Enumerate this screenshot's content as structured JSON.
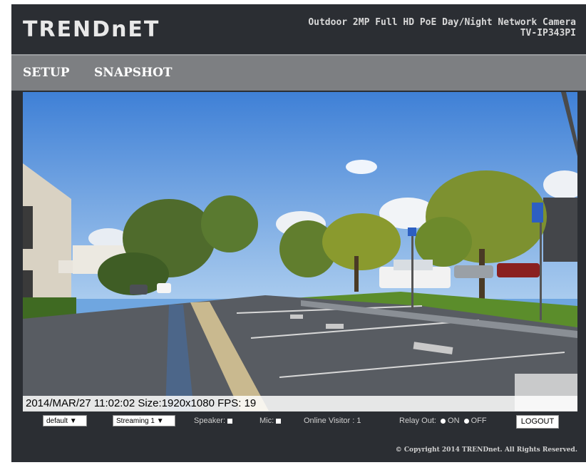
{
  "header": {
    "logo": "TRENDnET",
    "model_line1": "Outdoor 2MP Full HD PoE Day/Night Network Camera",
    "model_line2": "TV-IP343PI"
  },
  "nav": {
    "setup": "SETUP",
    "snapshot": "SNAPSHOT"
  },
  "video": {
    "osd_text": "2014/MAR/27 11:02:02 Size:1920x1080 FPS: 19"
  },
  "controls": {
    "profile_select": "default ▼",
    "stream_select": "Streaming 1 ▼",
    "speaker_label": "Speaker:",
    "mic_label": "Mic:",
    "online_visitor": "Online Visitor : 1",
    "relay_label": "Relay Out:",
    "relay_on": "ON",
    "relay_off": "OFF",
    "logout": "LOGOUT"
  },
  "footer": {
    "copyright": "© Copyright 2014 TRENDnet. All Rights Reserved."
  }
}
